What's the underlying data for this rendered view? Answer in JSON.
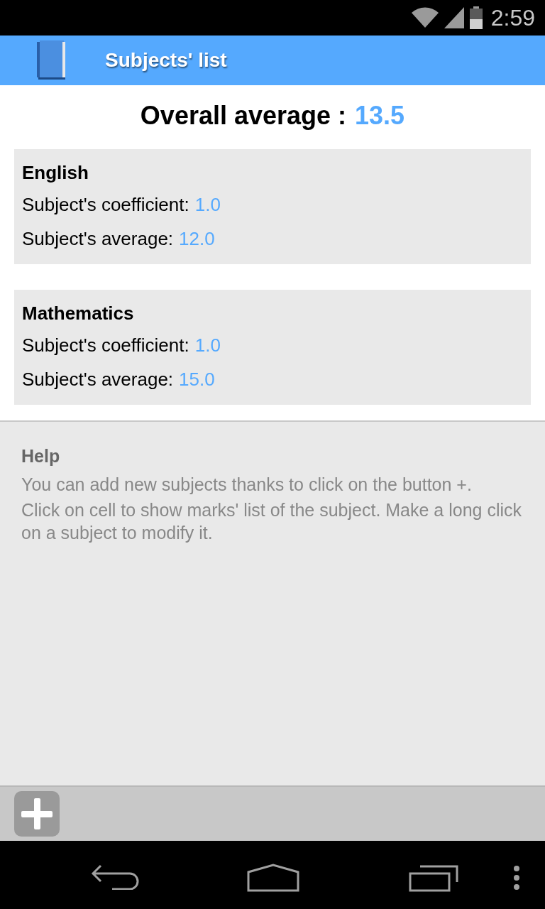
{
  "status_bar": {
    "time": "2:59"
  },
  "app_bar": {
    "title": "Subjects' list"
  },
  "overall": {
    "label": "Overall average :",
    "value": "13.5"
  },
  "subjects": [
    {
      "name": "English",
      "coefficient_label": "Subject's coefficient:",
      "coefficient": "1.0",
      "average_label": "Subject's average:",
      "average": "12.0"
    },
    {
      "name": "Mathematics",
      "coefficient_label": "Subject's coefficient:",
      "coefficient": "1.0",
      "average_label": "Subject's average:",
      "average": "15.0"
    }
  ],
  "help": {
    "title": "Help",
    "paragraphs": [
      "You can add new subjects thanks to click on the button +.",
      "Click on cell to show marks' list of the subject. Make a long click on a subject to modify it."
    ]
  }
}
